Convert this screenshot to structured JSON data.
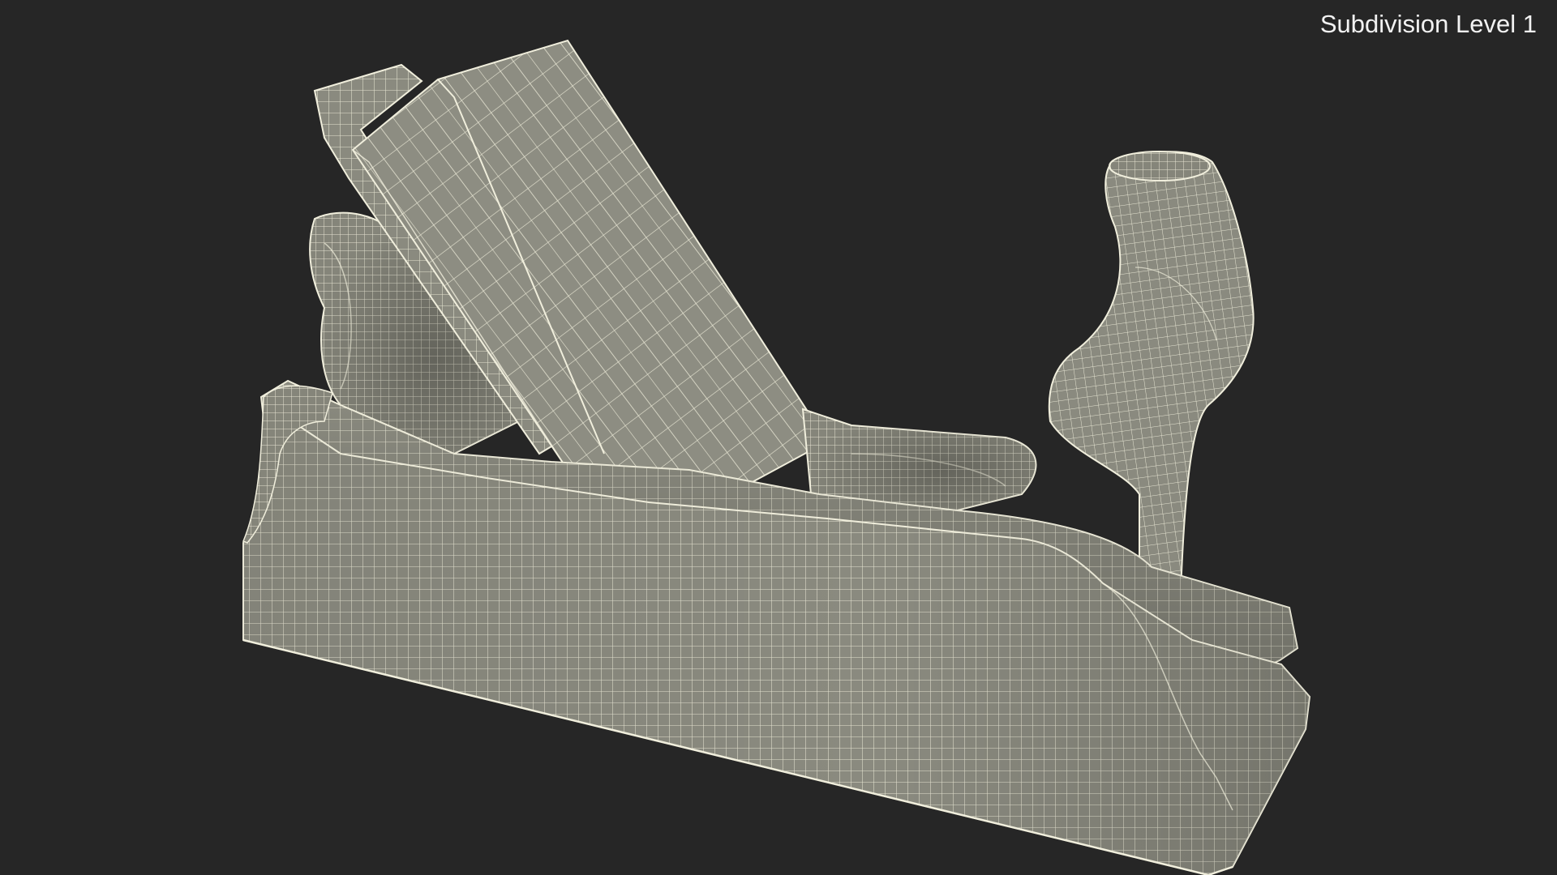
{
  "viewport": {
    "label": "Subdivision Level 1",
    "background_color": "#262626"
  },
  "model": {
    "subject": "wooden hand plane",
    "render_style": "wireframe over shaded mesh",
    "surface_color": "#8b8b80",
    "wire_color": "#e8e6d4"
  }
}
